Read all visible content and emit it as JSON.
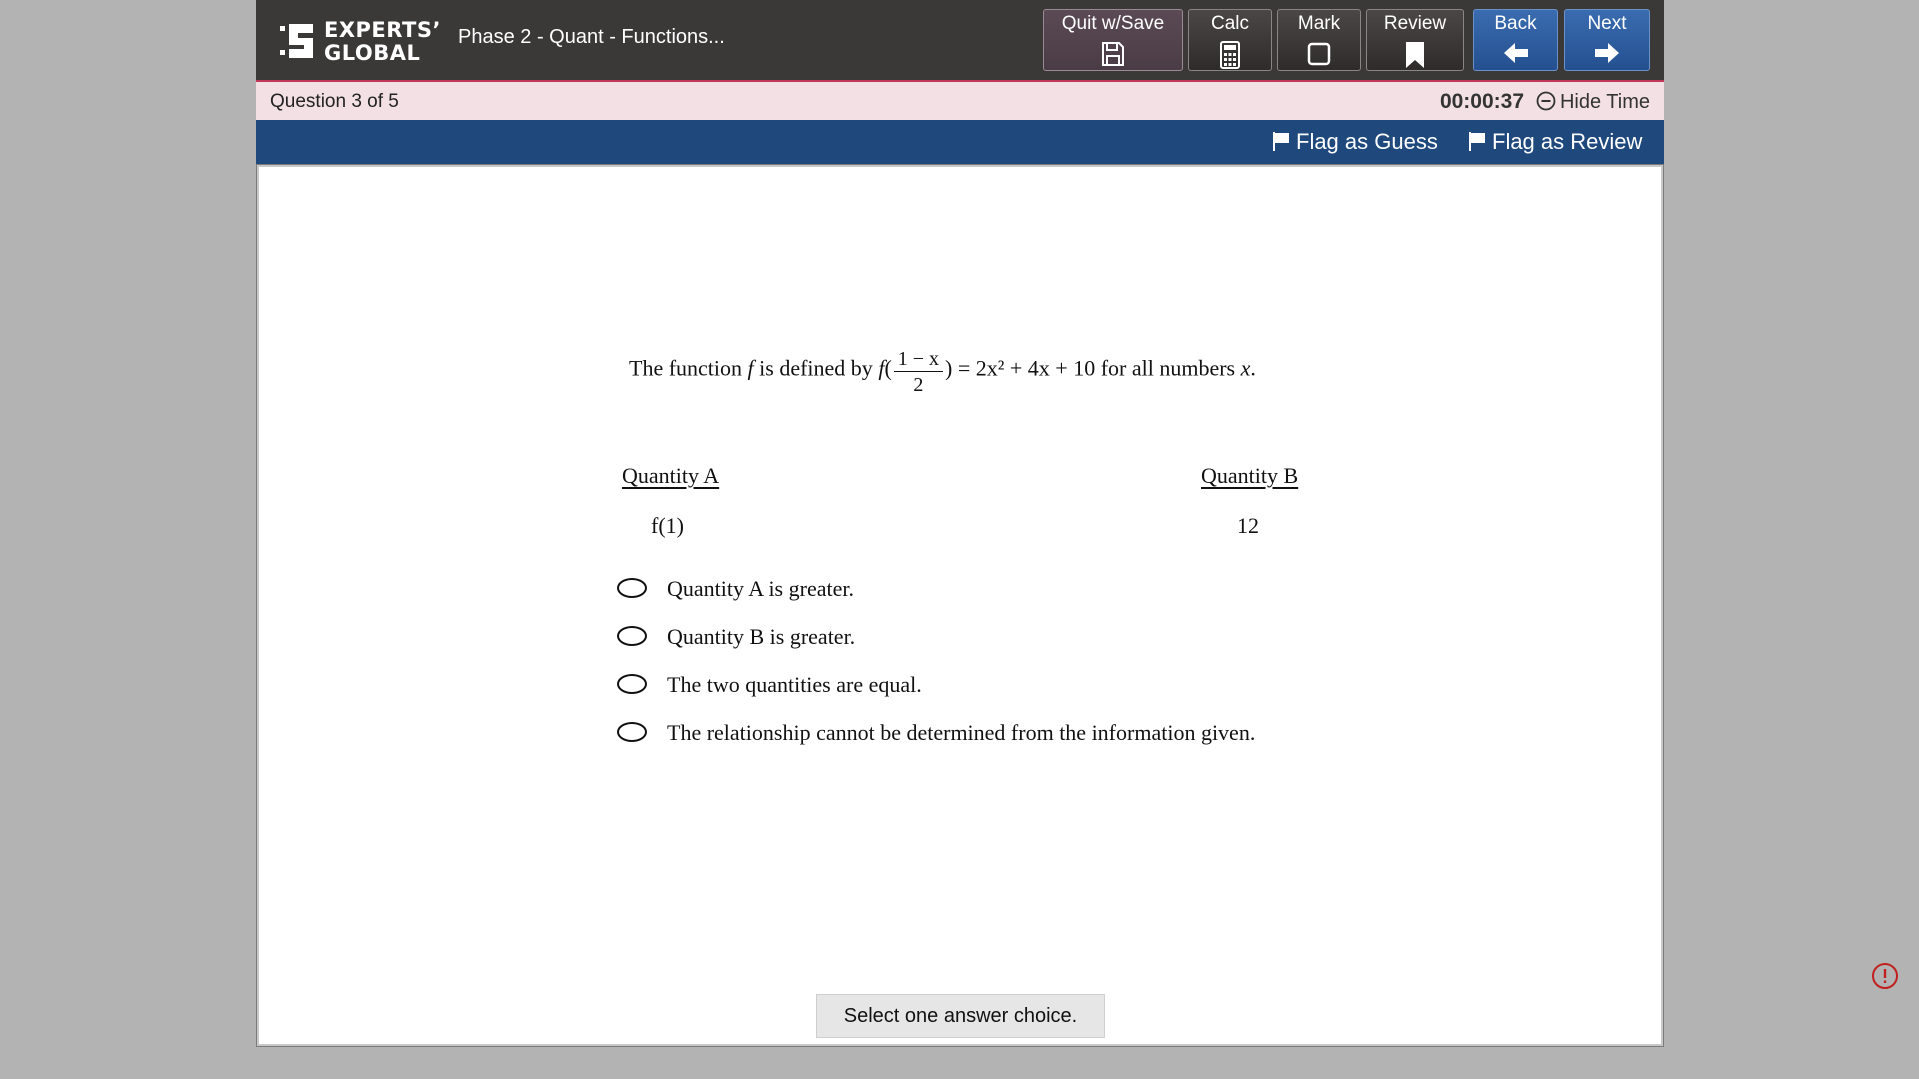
{
  "header": {
    "logo_line1": "EXPERTS’",
    "logo_line2": "GLOBAL",
    "exam_title": "Phase 2 - Quant - Functions...",
    "buttons": {
      "quit": "Quit w/Save",
      "calc": "Calc",
      "mark": "Mark",
      "review": "Review",
      "back": "Back",
      "next": "Next"
    }
  },
  "infobar": {
    "question_count": "Question 3 of 5",
    "timer": "00:00:37",
    "hide_time": "Hide Time"
  },
  "flagbar": {
    "flag_guess": "Flag as Guess",
    "flag_review": "Flag as Review"
  },
  "question": {
    "stem_prefix": "The function",
    "stem_f": "f",
    "stem_mid": "is defined by",
    "stem_f2": "f",
    "frac_num": "1 − x",
    "frac_den": "2",
    "stem_eq": "= 2x² + 4x + 10 for all numbers",
    "stem_x": "x",
    "stem_end": ".",
    "quantity_a_label": "Quantity A",
    "quantity_b_label": "Quantity B",
    "quantity_a_value": "f(1)",
    "quantity_b_value": "12",
    "choices": [
      "Quantity A is greater.",
      "Quantity B is greater.",
      "The two quantities are equal.",
      "The relationship cannot be determined from the information given."
    ],
    "hint": "Select one answer choice."
  },
  "colors": {
    "header_bg": "#3b3838",
    "flagbar_bg": "#1f497d",
    "infobar_bg": "#f2e0e5",
    "nav_blue": "#2d5c9e"
  },
  "icons": [
    "logo-mark-icon",
    "save-icon",
    "calculator-icon",
    "checkbox-icon",
    "bookmark-icon",
    "arrow-left-icon",
    "arrow-right-icon",
    "minus-circle-icon",
    "flag-icon",
    "error-icon"
  ]
}
